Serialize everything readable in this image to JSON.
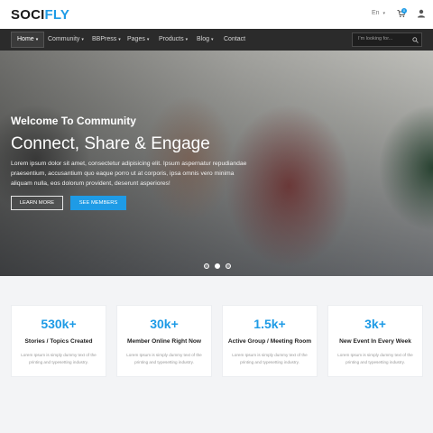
{
  "header": {
    "logo_part1": "SOCI",
    "logo_part2": "FLY",
    "language": "En",
    "cart_count": "0"
  },
  "nav": {
    "items": [
      {
        "label": "Home"
      },
      {
        "label": "Community"
      },
      {
        "label": "BBPress"
      },
      {
        "label": "Pages"
      },
      {
        "label": "Products"
      },
      {
        "label": "Blog"
      },
      {
        "label": "Contact"
      }
    ],
    "search_placeholder": "I'm looking for..."
  },
  "hero": {
    "kicker": "Welcome To Community",
    "title": "Connect, Share & Engage",
    "description": "Lorem ipsum dolor sit amet, consectetur adipisicing elit. Ipsum aspernatur repudiandae praesentium, accusantium quo eaque porro ut at corporis, ipsa omnis vero minima aliquam nulla, eos dolorum provident, deserunt asperiores!",
    "learn_more": "LEARN MORE",
    "see_members": "SEE MEMBERS",
    "slides": 3,
    "active_slide": 2
  },
  "stats": [
    {
      "number": "530k+",
      "title": "Stories / Topics Created",
      "text": "Lorem Ipsum is simply dummy text of the printing and typesetting industry."
    },
    {
      "number": "30k+",
      "title": "Member Online Right Now",
      "text": "Lorem Ipsum is simply dummy text of the printing and typesetting industry."
    },
    {
      "number": "1.5k+",
      "title": "Active Group / Meeting Room",
      "text": "Lorem Ipsum is simply dummy text of the printing and typesetting industry."
    },
    {
      "number": "3k+",
      "title": "New Event In Every Week",
      "text": "Lorem Ipsum is simply dummy text of the printing and typesetting industry."
    }
  ],
  "colors": {
    "accent": "#1e9be6",
    "nav_bg": "#2b2b2b",
    "stats_bg": "#f3f4f6"
  }
}
